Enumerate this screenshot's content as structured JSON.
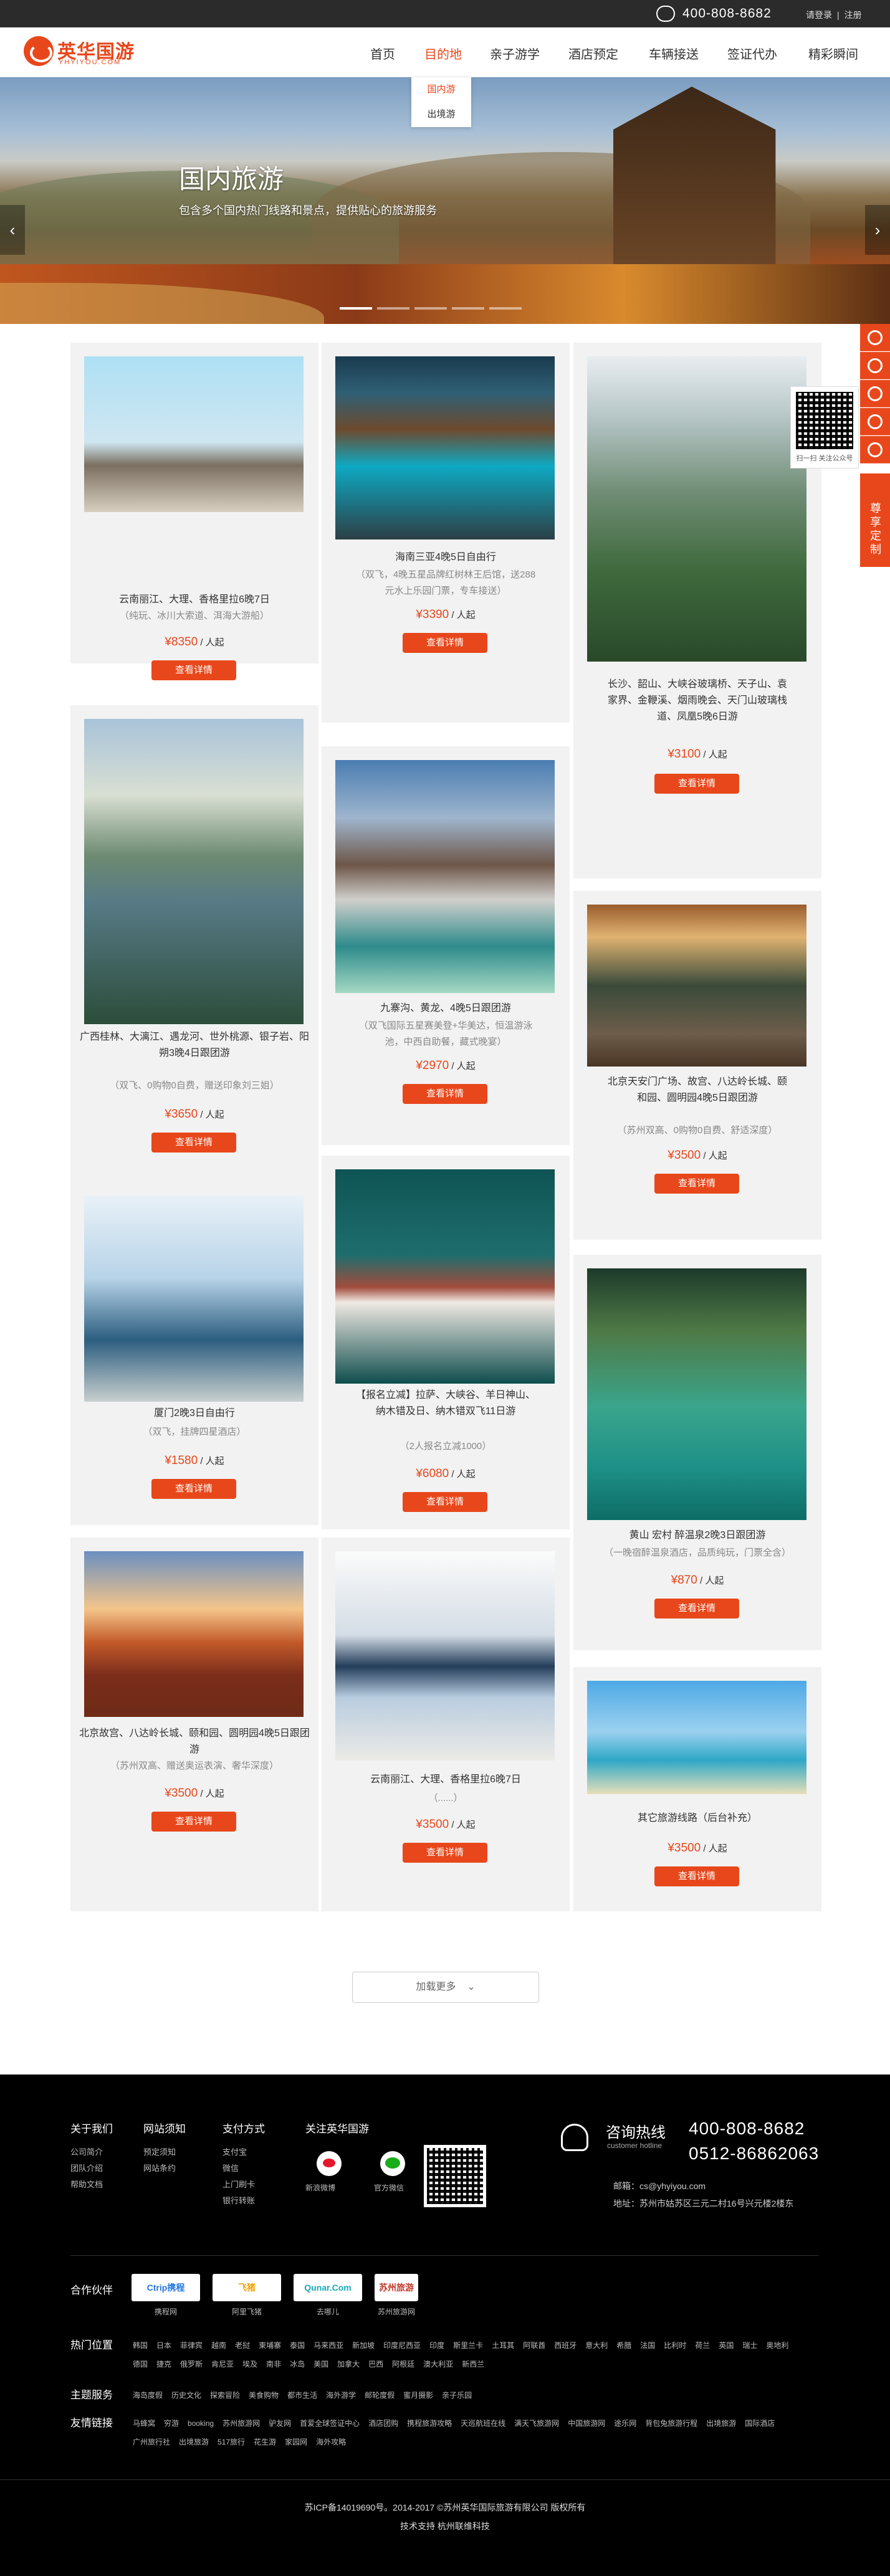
{
  "topbar": {
    "phone": "400-808-8682",
    "login": "请登录",
    "register": "注册"
  },
  "logo": {
    "cn": "英华国游",
    "en": "YHYIYOU.COM"
  },
  "nav": [
    {
      "label": "首页"
    },
    {
      "label": "目的地"
    },
    {
      "label": "亲子游学"
    },
    {
      "label": "酒店预定"
    },
    {
      "label": "车辆接送"
    },
    {
      "label": "签证代办"
    },
    {
      "label": "精彩瞬间"
    }
  ],
  "dropdown": {
    "domestic": "国内游",
    "outbound": "出境游"
  },
  "banner": {
    "title": "国内旅游",
    "subtitle": "包含多个国内热门线路和景点，提供贴心的旅游服务",
    "prev_icon": "chevron-left-icon",
    "next_icon": "chevron-right-icon"
  },
  "cards": [
    {
      "title": "云南丽江、大理、香格里拉6晚7日",
      "sub": "（纯玩、冰川大索道、洱海大游船）",
      "price": "¥8350",
      "unit": " / 人起",
      "button": "查看详情"
    },
    {
      "title": "海南三亚4晚5日自由行",
      "sub": "（双飞，4晚五星品牌红树林王后馆，送288元水上乐园门票，专车接送）",
      "price": "¥3390",
      "unit": " / 人起",
      "button": "查看详情"
    },
    {
      "title": "长沙、韶山、大峡谷玻璃桥、天子山、袁家界、金鞭溪、烟雨晚会、天门山玻璃栈道、凤凰5晚6日游",
      "sub": "",
      "price": "¥3100",
      "unit": " / 人起",
      "button": "查看详情"
    },
    {
      "title": "广西桂林、大漓江、遇龙河、世外桃源、银子岩、阳朔3晚4日跟团游",
      "sub": "（双飞、0购物0自费，赠送印象刘三姐）",
      "price": "¥3650",
      "unit": " / 人起",
      "button": "查看详情"
    },
    {
      "title": "九寨沟、黄龙、4晚5日跟团游",
      "sub": "（双飞国际五星赛美登+华美达，恒温游泳池，中西自助餐，藏式晚宴）",
      "price": "¥2970",
      "unit": " / 人起",
      "button": "查看详情"
    },
    {
      "title": "北京天安门广场、故宫、八达岭长城、颐和园、圆明园4晚5日跟团游",
      "sub": "（苏州双高、0购物0自费、舒适深度）",
      "price": "¥3500",
      "unit": " / 人起",
      "button": "查看详情"
    },
    {
      "title": "厦门2晚3日自由行",
      "sub": "（双飞，挂牌四星酒店）",
      "price": "¥1580",
      "unit": " / 人起",
      "button": "查看详情"
    },
    {
      "title": "【报名立减】拉萨、大峡谷、羊日神山、纳木错及日、纳木错双飞11日游",
      "sub": "（2人报名立减1000）",
      "price": "¥6080",
      "unit": " / 人起",
      "button": "查看详情"
    },
    {
      "title": "黄山 宏村 醉温泉2晚3日跟团游",
      "sub": "（一晚宿醉温泉酒店，品质纯玩，门票全含）",
      "price": "¥870",
      "unit": " / 人起",
      "button": "查看详情"
    },
    {
      "title": "北京故宫、八达岭长城、颐和园、圆明园4晚5日跟团游",
      "sub": "（苏州双高、赠送奥运表演、奢华深度）",
      "price": "¥3500",
      "unit": " / 人起",
      "button": "查看详情"
    },
    {
      "title": "云南丽江、大理、香格里拉6晚7日",
      "sub": "（......）",
      "price": "¥3500",
      "unit": " / 人起",
      "button": "查看详情"
    },
    {
      "title": "其它旅游线路（后台补充）",
      "sub": "",
      "price": "¥3500",
      "unit": " / 人起",
      "button": "查看详情"
    }
  ],
  "load_more": "加载更多",
  "side_float": {
    "custom": "尊享定制",
    "qr_caption": "扫一扫  关注公众号"
  },
  "footer": {
    "cols": [
      {
        "title": "关于我们",
        "items": [
          "公司简介",
          "团队介绍",
          "帮助文档"
        ]
      },
      {
        "title": "网站须知",
        "items": [
          "预定须知",
          "网站条约"
        ]
      },
      {
        "title": "支付方式",
        "items": [
          "支付宝",
          "微信",
          "上门刷卡",
          "银行转账"
        ]
      }
    ],
    "follow": {
      "title": "关注英华国游",
      "weibo": "新浪微博",
      "wechat": "官方微信"
    },
    "hotline": {
      "title": "咨询热线",
      "subtitle": "customer hotline",
      "tel1": "400-808-8682",
      "tel2": "0512-86862063",
      "email": "邮箱：cs@yhyiyou.com",
      "address": "地址：苏州市姑苏区三元二村16号兴元楼2楼东"
    },
    "partners": {
      "label": "合作伙伴",
      "items": [
        {
          "logo": "Ctrip携程",
          "name": "携程网",
          "color": "#2577e3"
        },
        {
          "logo": "飞猪",
          "name": "阿里飞猪",
          "color": "#f2a001"
        },
        {
          "logo": "Qunar.Com",
          "name": "去哪儿",
          "color": "#1ba9ba"
        },
        {
          "logo": "苏州旅游",
          "name": "苏州旅游网",
          "color": "#c0392b"
        }
      ]
    },
    "hot": {
      "label": "热门位置",
      "items": [
        "韩国",
        "日本",
        "菲律宾",
        "越南",
        "老挝",
        "柬埔寨",
        "泰国",
        "马来西亚",
        "新加坡",
        "印度尼西亚",
        "印度",
        "斯里兰卡",
        "土耳其",
        "阿联酋",
        "西班牙",
        "意大利",
        "希腊",
        "法国",
        "比利时",
        "荷兰",
        "英国",
        "瑞士",
        "奥地利",
        "德国",
        "捷克",
        "俄罗斯",
        "肯尼亚",
        "埃及",
        "南非",
        "冰岛",
        "美国",
        "加拿大",
        "巴西",
        "阿根廷",
        "澳大利亚",
        "新西兰"
      ]
    },
    "theme": {
      "label": "主题服务",
      "items": [
        "海岛度假",
        "历史文化",
        "探索冒险",
        "美食购物",
        "都市生活",
        "海外游学",
        "邮轮度假",
        "蜜月摄影",
        "亲子乐园"
      ]
    },
    "friends": {
      "label": "友情链接",
      "items": [
        "马蜂窝",
        "穷游",
        "booking",
        "苏州旅游网",
        "驴友网",
        "首爱全球签证中心",
        "酒店团购",
        "携程旅游攻略",
        "天巡航班在线",
        "满天飞旅游网",
        "中国旅游网",
        "途乐网",
        "背包兔旅游行程",
        "出境旅游",
        "国际酒店",
        "广州旅行社",
        "出境旅游",
        "517旅行",
        "花生游",
        "家园网",
        "海外攻略"
      ]
    },
    "copyright": "苏ICP备14019690号。2014-2017 ©苏州英华国际旅游有限公司 版权所有",
    "support": "技术支持 杭州联维科技"
  }
}
